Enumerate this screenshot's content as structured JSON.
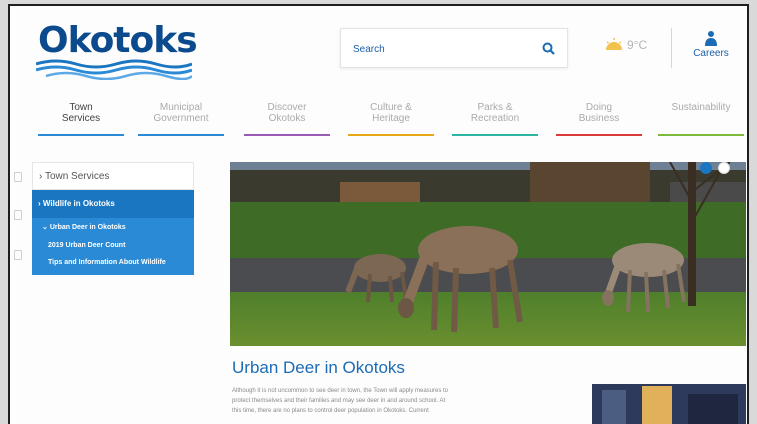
{
  "header": {
    "logo_text": "Okotoks",
    "search_placeholder": "Search",
    "weather_temp": "9°C",
    "careers_label": "Careers"
  },
  "nav": {
    "items": [
      {
        "line1": "Town",
        "line2": "Services",
        "color": "#2a8ad6",
        "active": true
      },
      {
        "line1": "Municipal",
        "line2": "Government",
        "color": "#2a8ad6",
        "active": false
      },
      {
        "line1": "Discover",
        "line2": "Okotoks",
        "color": "#9b59b6",
        "active": false
      },
      {
        "line1": "Culture &",
        "line2": "Heritage",
        "color": "#e6a817",
        "active": false
      },
      {
        "line1": "Parks &",
        "line2": "Recreation",
        "color": "#2db5a3",
        "active": false
      },
      {
        "line1": "Doing",
        "line2": "Business",
        "color": "#d93b3b",
        "active": false
      },
      {
        "line1": "",
        "line2": "Sustainability",
        "color": "#7dbb3c",
        "active": false
      }
    ]
  },
  "sidebar": {
    "heading": "Town Services",
    "level1": "Wildlife in Okotoks",
    "level2": "Urban Deer in Okotoks",
    "level3": [
      "2019 Urban Deer Count",
      "Tips and Information About Wildlife"
    ]
  },
  "main": {
    "title": "Urban Deer in Okotoks",
    "body_lines": [
      "Although it is not uncommon to see deer in town, the Town will apply measures to",
      "protect themselves and their families and may see deer in and around school. At",
      "this time, there are no plans to control deer population in Okotoks. Current"
    ]
  },
  "carousel": {
    "slide_count": 2,
    "active_slide": 1
  },
  "colors": {
    "brand_blue": "#1b6bb5",
    "sidebar_active": "#1b76c2",
    "sidebar_sub": "#2a8ad6"
  }
}
